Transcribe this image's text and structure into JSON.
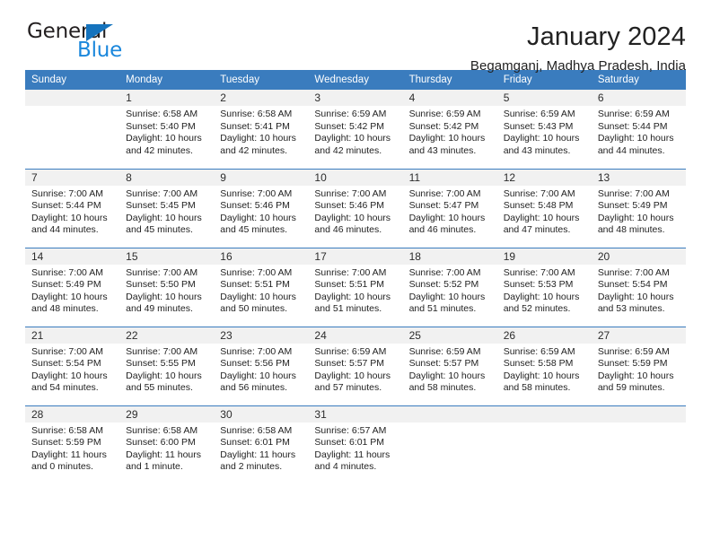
{
  "logo": {
    "word_top": "General",
    "word_bottom": "Blue",
    "triangle_icon": "triangle-icon",
    "color_dark": "#231f20",
    "color_blue": "#1a87dc",
    "triangle_color": "#1573bd"
  },
  "header": {
    "title": "January 2024",
    "subtitle": "Begamganj, Madhya Pradesh, India"
  },
  "theme": {
    "header_bg": "#3a7cbe",
    "header_text": "#ffffff",
    "daynum_bg": "#f1f1f1",
    "cell_bg": "#ffffff",
    "grid_line": "#3a7cbe"
  },
  "weekdays": [
    "Sunday",
    "Monday",
    "Tuesday",
    "Wednesday",
    "Thursday",
    "Friday",
    "Saturday"
  ],
  "weeks": [
    [
      {
        "day": "",
        "sunrise": "",
        "sunset": "",
        "daylight_1": "",
        "daylight_2": "",
        "blank": true
      },
      {
        "day": "1",
        "sunrise": "Sunrise: 6:58 AM",
        "sunset": "Sunset: 5:40 PM",
        "daylight_1": "Daylight: 10 hours",
        "daylight_2": "and 42 minutes.",
        "blank": false
      },
      {
        "day": "2",
        "sunrise": "Sunrise: 6:58 AM",
        "sunset": "Sunset: 5:41 PM",
        "daylight_1": "Daylight: 10 hours",
        "daylight_2": "and 42 minutes.",
        "blank": false
      },
      {
        "day": "3",
        "sunrise": "Sunrise: 6:59 AM",
        "sunset": "Sunset: 5:42 PM",
        "daylight_1": "Daylight: 10 hours",
        "daylight_2": "and 42 minutes.",
        "blank": false
      },
      {
        "day": "4",
        "sunrise": "Sunrise: 6:59 AM",
        "sunset": "Sunset: 5:42 PM",
        "daylight_1": "Daylight: 10 hours",
        "daylight_2": "and 43 minutes.",
        "blank": false
      },
      {
        "day": "5",
        "sunrise": "Sunrise: 6:59 AM",
        "sunset": "Sunset: 5:43 PM",
        "daylight_1": "Daylight: 10 hours",
        "daylight_2": "and 43 minutes.",
        "blank": false
      },
      {
        "day": "6",
        "sunrise": "Sunrise: 6:59 AM",
        "sunset": "Sunset: 5:44 PM",
        "daylight_1": "Daylight: 10 hours",
        "daylight_2": "and 44 minutes.",
        "blank": false
      }
    ],
    [
      {
        "day": "7",
        "sunrise": "Sunrise: 7:00 AM",
        "sunset": "Sunset: 5:44 PM",
        "daylight_1": "Daylight: 10 hours",
        "daylight_2": "and 44 minutes.",
        "blank": false
      },
      {
        "day": "8",
        "sunrise": "Sunrise: 7:00 AM",
        "sunset": "Sunset: 5:45 PM",
        "daylight_1": "Daylight: 10 hours",
        "daylight_2": "and 45 minutes.",
        "blank": false
      },
      {
        "day": "9",
        "sunrise": "Sunrise: 7:00 AM",
        "sunset": "Sunset: 5:46 PM",
        "daylight_1": "Daylight: 10 hours",
        "daylight_2": "and 45 minutes.",
        "blank": false
      },
      {
        "day": "10",
        "sunrise": "Sunrise: 7:00 AM",
        "sunset": "Sunset: 5:46 PM",
        "daylight_1": "Daylight: 10 hours",
        "daylight_2": "and 46 minutes.",
        "blank": false
      },
      {
        "day": "11",
        "sunrise": "Sunrise: 7:00 AM",
        "sunset": "Sunset: 5:47 PM",
        "daylight_1": "Daylight: 10 hours",
        "daylight_2": "and 46 minutes.",
        "blank": false
      },
      {
        "day": "12",
        "sunrise": "Sunrise: 7:00 AM",
        "sunset": "Sunset: 5:48 PM",
        "daylight_1": "Daylight: 10 hours",
        "daylight_2": "and 47 minutes.",
        "blank": false
      },
      {
        "day": "13",
        "sunrise": "Sunrise: 7:00 AM",
        "sunset": "Sunset: 5:49 PM",
        "daylight_1": "Daylight: 10 hours",
        "daylight_2": "and 48 minutes.",
        "blank": false
      }
    ],
    [
      {
        "day": "14",
        "sunrise": "Sunrise: 7:00 AM",
        "sunset": "Sunset: 5:49 PM",
        "daylight_1": "Daylight: 10 hours",
        "daylight_2": "and 48 minutes.",
        "blank": false
      },
      {
        "day": "15",
        "sunrise": "Sunrise: 7:00 AM",
        "sunset": "Sunset: 5:50 PM",
        "daylight_1": "Daylight: 10 hours",
        "daylight_2": "and 49 minutes.",
        "blank": false
      },
      {
        "day": "16",
        "sunrise": "Sunrise: 7:00 AM",
        "sunset": "Sunset: 5:51 PM",
        "daylight_1": "Daylight: 10 hours",
        "daylight_2": "and 50 minutes.",
        "blank": false
      },
      {
        "day": "17",
        "sunrise": "Sunrise: 7:00 AM",
        "sunset": "Sunset: 5:51 PM",
        "daylight_1": "Daylight: 10 hours",
        "daylight_2": "and 51 minutes.",
        "blank": false
      },
      {
        "day": "18",
        "sunrise": "Sunrise: 7:00 AM",
        "sunset": "Sunset: 5:52 PM",
        "daylight_1": "Daylight: 10 hours",
        "daylight_2": "and 51 minutes.",
        "blank": false
      },
      {
        "day": "19",
        "sunrise": "Sunrise: 7:00 AM",
        "sunset": "Sunset: 5:53 PM",
        "daylight_1": "Daylight: 10 hours",
        "daylight_2": "and 52 minutes.",
        "blank": false
      },
      {
        "day": "20",
        "sunrise": "Sunrise: 7:00 AM",
        "sunset": "Sunset: 5:54 PM",
        "daylight_1": "Daylight: 10 hours",
        "daylight_2": "and 53 minutes.",
        "blank": false
      }
    ],
    [
      {
        "day": "21",
        "sunrise": "Sunrise: 7:00 AM",
        "sunset": "Sunset: 5:54 PM",
        "daylight_1": "Daylight: 10 hours",
        "daylight_2": "and 54 minutes.",
        "blank": false
      },
      {
        "day": "22",
        "sunrise": "Sunrise: 7:00 AM",
        "sunset": "Sunset: 5:55 PM",
        "daylight_1": "Daylight: 10 hours",
        "daylight_2": "and 55 minutes.",
        "blank": false
      },
      {
        "day": "23",
        "sunrise": "Sunrise: 7:00 AM",
        "sunset": "Sunset: 5:56 PM",
        "daylight_1": "Daylight: 10 hours",
        "daylight_2": "and 56 minutes.",
        "blank": false
      },
      {
        "day": "24",
        "sunrise": "Sunrise: 6:59 AM",
        "sunset": "Sunset: 5:57 PM",
        "daylight_1": "Daylight: 10 hours",
        "daylight_2": "and 57 minutes.",
        "blank": false
      },
      {
        "day": "25",
        "sunrise": "Sunrise: 6:59 AM",
        "sunset": "Sunset: 5:57 PM",
        "daylight_1": "Daylight: 10 hours",
        "daylight_2": "and 58 minutes.",
        "blank": false
      },
      {
        "day": "26",
        "sunrise": "Sunrise: 6:59 AM",
        "sunset": "Sunset: 5:58 PM",
        "daylight_1": "Daylight: 10 hours",
        "daylight_2": "and 58 minutes.",
        "blank": false
      },
      {
        "day": "27",
        "sunrise": "Sunrise: 6:59 AM",
        "sunset": "Sunset: 5:59 PM",
        "daylight_1": "Daylight: 10 hours",
        "daylight_2": "and 59 minutes.",
        "blank": false
      }
    ],
    [
      {
        "day": "28",
        "sunrise": "Sunrise: 6:58 AM",
        "sunset": "Sunset: 5:59 PM",
        "daylight_1": "Daylight: 11 hours",
        "daylight_2": "and 0 minutes.",
        "blank": false
      },
      {
        "day": "29",
        "sunrise": "Sunrise: 6:58 AM",
        "sunset": "Sunset: 6:00 PM",
        "daylight_1": "Daylight: 11 hours",
        "daylight_2": "and 1 minute.",
        "blank": false
      },
      {
        "day": "30",
        "sunrise": "Sunrise: 6:58 AM",
        "sunset": "Sunset: 6:01 PM",
        "daylight_1": "Daylight: 11 hours",
        "daylight_2": "and 2 minutes.",
        "blank": false
      },
      {
        "day": "31",
        "sunrise": "Sunrise: 6:57 AM",
        "sunset": "Sunset: 6:01 PM",
        "daylight_1": "Daylight: 11 hours",
        "daylight_2": "and 4 minutes.",
        "blank": false
      },
      {
        "day": "",
        "sunrise": "",
        "sunset": "",
        "daylight_1": "",
        "daylight_2": "",
        "blank": true
      },
      {
        "day": "",
        "sunrise": "",
        "sunset": "",
        "daylight_1": "",
        "daylight_2": "",
        "blank": true
      },
      {
        "day": "",
        "sunrise": "",
        "sunset": "",
        "daylight_1": "",
        "daylight_2": "",
        "blank": true
      }
    ]
  ]
}
